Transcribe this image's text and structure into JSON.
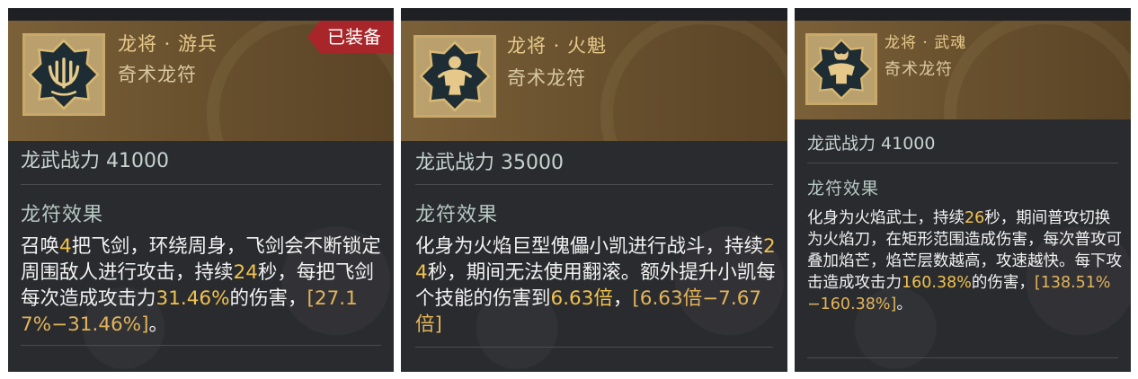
{
  "colors": {
    "card_bg": "#2a2b2f",
    "header_bg": "#7b6139",
    "name_gold": "#e6c98a",
    "highlight": "#f0c24e",
    "equipped_red": "#a8262a"
  },
  "cards": [
    {
      "icon": "trident-emblem-icon",
      "name": "龙将 · 游兵",
      "type": "奇术龙符",
      "equipped_badge": "已装备",
      "power_label": "龙武战力 41000",
      "effect_title": "龙符效果",
      "desc": [
        {
          "t": "召唤"
        },
        {
          "h": "4"
        },
        {
          "t": "把飞剑，环绕周身，飞剑会不断锁定周围敌人进行攻击，持续"
        },
        {
          "h": "24"
        },
        {
          "t": "秒，每把飞剑每次造成攻击力"
        },
        {
          "h": "31.46%"
        },
        {
          "t": "的伤害，"
        },
        {
          "b": "[27.17%−31.46%]"
        },
        {
          "t": "。"
        }
      ]
    },
    {
      "icon": "flame-puppet-icon",
      "name": "龙将 · 火魁",
      "type": "奇术龙符",
      "power_label": "龙武战力 35000",
      "effect_title": "龙符效果",
      "desc": [
        {
          "t": "化身为火焰巨型傀儡小凯进行战斗，持续"
        },
        {
          "h": "24"
        },
        {
          "t": "秒，期间无法使用翻滚。额外提升小凯每个技能的伤害到"
        },
        {
          "h": "6.63倍"
        },
        {
          "t": "，"
        },
        {
          "b": "[6.63倍−7.67倍]"
        }
      ]
    },
    {
      "icon": "flame-warrior-icon",
      "name": "龙将 · 武魂",
      "type": "奇术龙符",
      "power_label": "龙武战力 41000",
      "effect_title": "龙符效果",
      "desc": [
        {
          "t": "化身为火焰武士，持续"
        },
        {
          "h": "26"
        },
        {
          "t": "秒，期间普攻切换为火焰刀，在矩形范围造成伤害，每次普攻可叠加焰芒，焰芒层数越高，攻速越快。每下攻击造成攻击力"
        },
        {
          "h": "160.38%"
        },
        {
          "t": "的伤害，"
        },
        {
          "b": "[138.51%−160.38%]"
        },
        {
          "t": "。"
        }
      ]
    }
  ]
}
